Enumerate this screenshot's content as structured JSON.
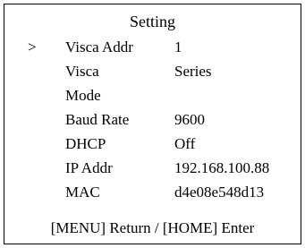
{
  "menu": {
    "title": "Setting",
    "cursor": ">",
    "rows": [
      {
        "label": "Visca Addr",
        "value": "1"
      },
      {
        "label": "Visca",
        "value": "Series"
      },
      {
        "label": "Mode",
        "value": ""
      },
      {
        "label": "Baud Rate",
        "value": "9600"
      },
      {
        "label": "DHCP",
        "value": "Off"
      },
      {
        "label": "IP Addr",
        "value": "192.168.100.88"
      },
      {
        "label": "MAC",
        "value": "d4e08e548d13"
      }
    ],
    "footer": "[MENU] Return / [HOME] Enter"
  }
}
